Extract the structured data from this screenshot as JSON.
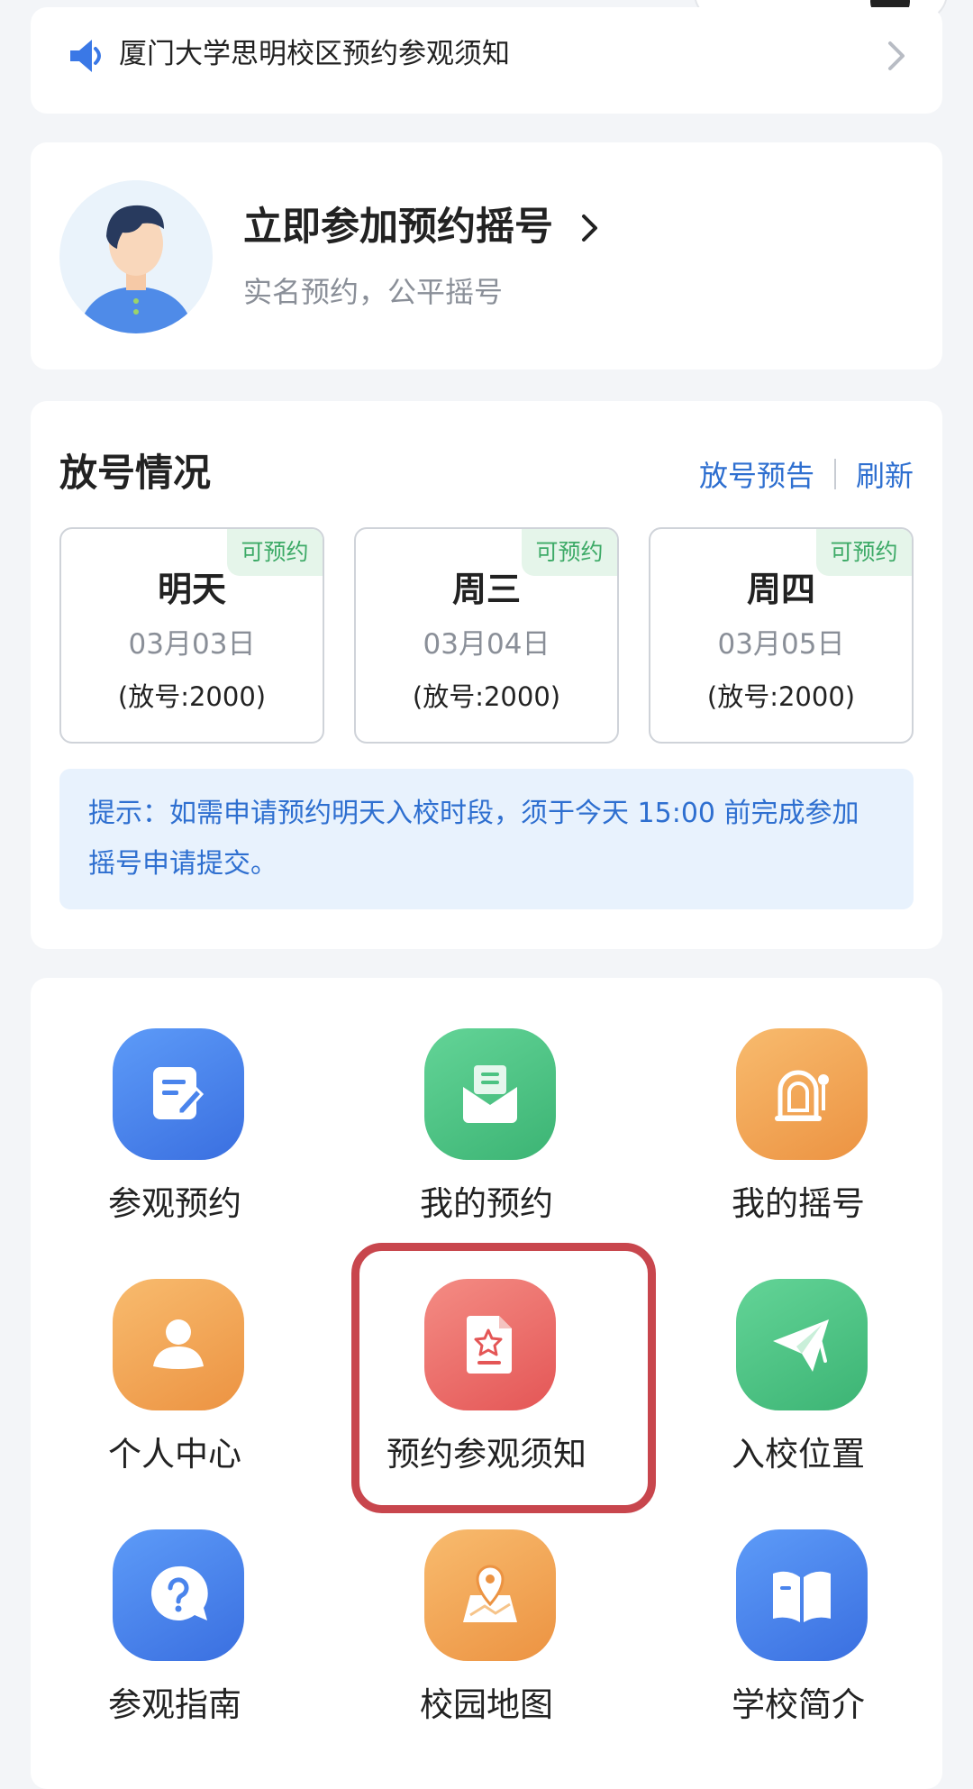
{
  "notice": {
    "text": "厦门大学思明校区预约参观须知"
  },
  "join": {
    "title": "立即参加预约摇号",
    "subtitle": "实名预约，公平摇号"
  },
  "release": {
    "heading": "放号情况",
    "preview_link": "放号预告",
    "refresh_link": "刷新",
    "days": [
      {
        "name": "明天",
        "date": "03月03日",
        "count": "(放号:2000)",
        "badge": "可预约"
      },
      {
        "name": "周三",
        "date": "03月04日",
        "count": "(放号:2000)",
        "badge": "可预约"
      },
      {
        "name": "周四",
        "date": "03月05日",
        "count": "(放号:2000)",
        "badge": "可预约"
      }
    ],
    "tip": "提示：如需申请预约明天入校时段，须于今天 15:00 前完成参加摇号申请提交。"
  },
  "menu": {
    "items": [
      {
        "label": "参观预约",
        "icon": "edit-note-icon",
        "color": "#4a84ec"
      },
      {
        "label": "我的预约",
        "icon": "envelope-icon",
        "color": "#4cc383"
      },
      {
        "label": "我的摇号",
        "icon": "lottery-machine-icon",
        "color": "#f0a452"
      },
      {
        "label": "个人中心",
        "icon": "user-icon",
        "color": "#f0a452"
      },
      {
        "label": "预约参观须知",
        "icon": "star-document-icon",
        "color": "#e86a66"
      },
      {
        "label": "入校位置",
        "icon": "paper-plane-icon",
        "color": "#4cc383"
      },
      {
        "label": "参观指南",
        "icon": "question-bubble-icon",
        "color": "#4a84ec"
      },
      {
        "label": "校园地图",
        "icon": "map-pin-icon",
        "color": "#f0a452"
      },
      {
        "label": "学校简介",
        "icon": "open-book-icon",
        "color": "#4a84ec"
      }
    ]
  }
}
